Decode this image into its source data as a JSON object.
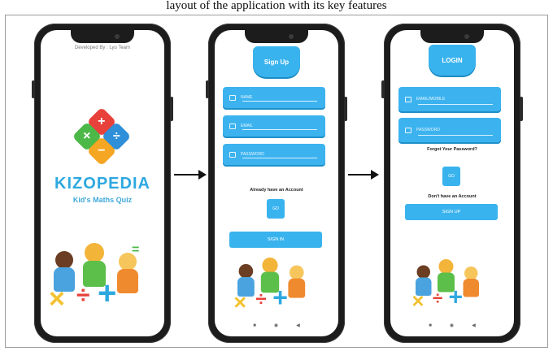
{
  "caption": "layout of the application with its key features",
  "splash": {
    "developer_note": "Developed By : Lyu Team",
    "logo_symbols": [
      "+",
      "×",
      "÷",
      "−"
    ],
    "brand_name": "KIZOPEDIA",
    "subtitle": "Kid's Maths Quiz"
  },
  "signup": {
    "header": "Sign Up",
    "fields": [
      {
        "placeholder": "NAME",
        "icon": "person-icon"
      },
      {
        "placeholder": "EMAIL",
        "icon": "mail-icon"
      },
      {
        "placeholder": "PASSWORD",
        "icon": "lock-icon"
      }
    ],
    "prompt": "Already have an Account",
    "go_label": "GO",
    "submit_label": "SIGN IN"
  },
  "login": {
    "header": "LOGIN",
    "fields": [
      {
        "placeholder": "EMAIL/MOBILE",
        "icon": "calendar-icon"
      },
      {
        "placeholder": "PASSWORD",
        "icon": "lock-icon"
      }
    ],
    "forgot": "Forgot Your Password?",
    "go_label": "GO",
    "prompt": "Don't have an Account",
    "submit_label": "SIGN UP"
  },
  "nav_icons": [
    "back-square-icon",
    "home-circle-icon",
    "back-triangle-icon"
  ],
  "colors": {
    "accent": "#39b3ee",
    "brand_blue": "#2ea8e0",
    "brand_orange": "#f0a81c",
    "tile_red": "#e8413b",
    "tile_green": "#4cb848",
    "tile_blue": "#2f8fd8",
    "tile_orange": "#f5a623"
  }
}
